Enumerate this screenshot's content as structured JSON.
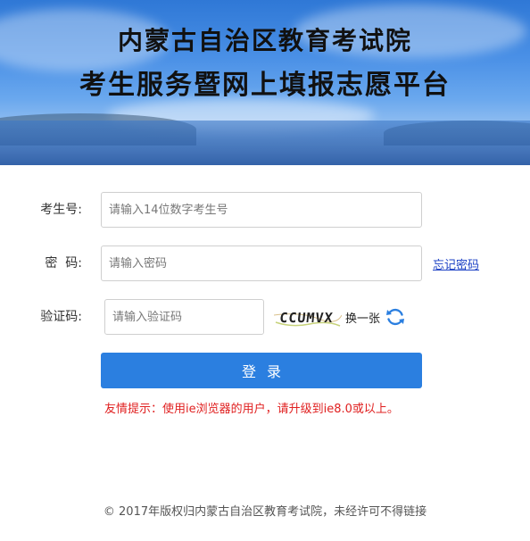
{
  "header": {
    "title_line1": "内蒙古自治区教育考试院",
    "title_line2": "考生服务暨网上填报志愿平台"
  },
  "form": {
    "exam_id": {
      "label": "考生号:",
      "placeholder": "请输入14位数字考生号",
      "value": ""
    },
    "password": {
      "label": "密  码:",
      "placeholder": "请输入密码",
      "value": "",
      "forgot_label": "忘记密码"
    },
    "captcha": {
      "label": "验证码:",
      "placeholder": "请输入验证码",
      "value": "",
      "image_text": "CCUMVX",
      "refresh_label": "换一张"
    },
    "login_label": "登录"
  },
  "notice": "友情提示：使用ie浏览器的用户，请升级到ie8.0或以上。",
  "footer": "© 2017年版权归内蒙古自治区教育考试院，未经许可不得链接",
  "colors": {
    "accent": "#2b7fe0",
    "warning": "#e02020",
    "link": "#1a3fc4"
  }
}
